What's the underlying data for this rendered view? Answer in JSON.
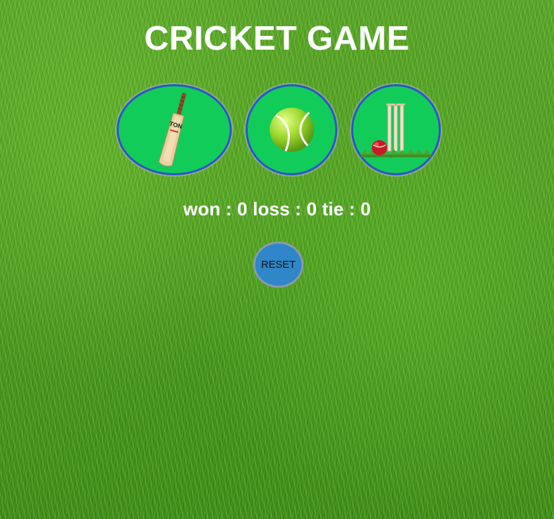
{
  "title": "CRICKET GAME",
  "choices": [
    {
      "name": "bat",
      "icon": "cricket-bat-icon",
      "brand": "TON"
    },
    {
      "name": "ball",
      "icon": "tennis-ball-icon"
    },
    {
      "name": "stump",
      "icon": "wickets-stumps-icon"
    }
  ],
  "score": {
    "won_label": "won :",
    "won": "0",
    "loss_label": "loss :",
    "loss": "0",
    "tie_label": "tie :",
    "tie": "0"
  },
  "reset_label": "RESET",
  "colors": {
    "button_fill": "#12cc5a",
    "button_border": "#2d54c8",
    "reset_fill": "#2f86c9",
    "text": "#ffffff"
  }
}
